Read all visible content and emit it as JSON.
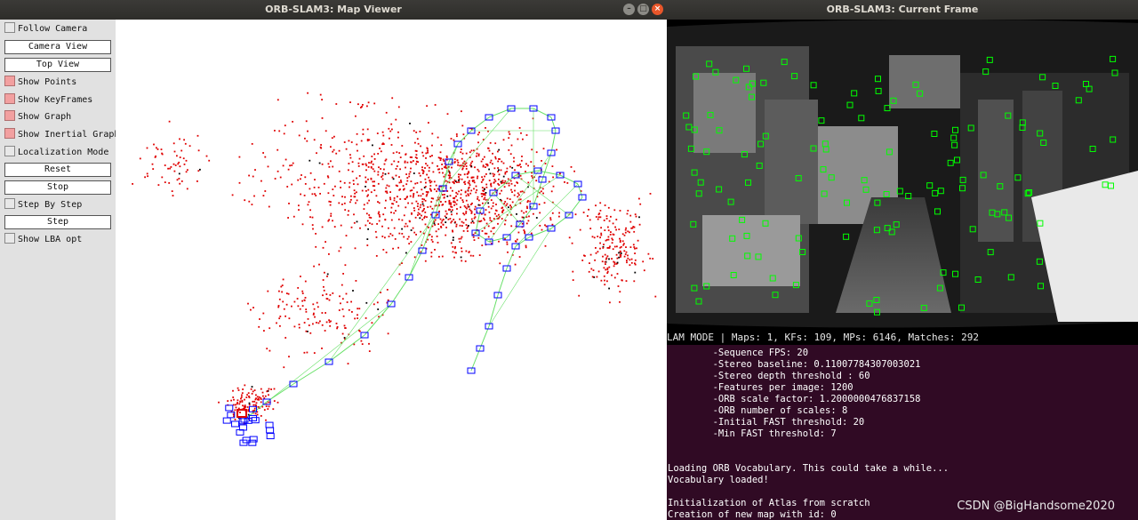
{
  "map_window": {
    "title": "ORB-SLAM3: Map Viewer",
    "panel": {
      "follow_camera": "Follow Camera",
      "camera_view": "Camera View",
      "top_view": "Top View",
      "show_points": "Show Points",
      "show_keyframes": "Show KeyFrames",
      "show_graph": "Show Graph",
      "show_inertial_graph": "Show Inertial Graph",
      "localization_mode": "Localization Mode",
      "reset": "Reset",
      "stop": "Stop",
      "step_by_step": "Step By Step",
      "step": "Step",
      "show_lba_opt": "Show LBA opt"
    }
  },
  "frame_window": {
    "title": "ORB-SLAM3: Current Frame",
    "status": "LAM MODE |  Maps: 1, KFs: 109, MPs: 6146, Matches: 292"
  },
  "terminal": {
    "lines": [
      "        -Sequence FPS: 20",
      "        -Stereo baseline: 0.11007784307003021",
      "        -Stereo depth threshold : 60",
      "        -Features per image: 1200",
      "        -ORB scale factor: 1.2000000476837158",
      "        -ORB number of scales: 8",
      "        -Initial FAST threshold: 20",
      "        -Min FAST threshold: 7",
      "",
      "",
      "Loading ORB Vocabulary. This could take a while...",
      "Vocabulary loaded!",
      "",
      "Initialization of Atlas from scratch",
      "Creation of new map with id: 0"
    ]
  },
  "watermark": "CSDN @BigHandsome2020",
  "colors": {
    "map_points": "#e00000",
    "keyframes": "#0000ff",
    "graph": "#66e066",
    "features": "#00ff00",
    "terminal_bg": "#300a24"
  }
}
